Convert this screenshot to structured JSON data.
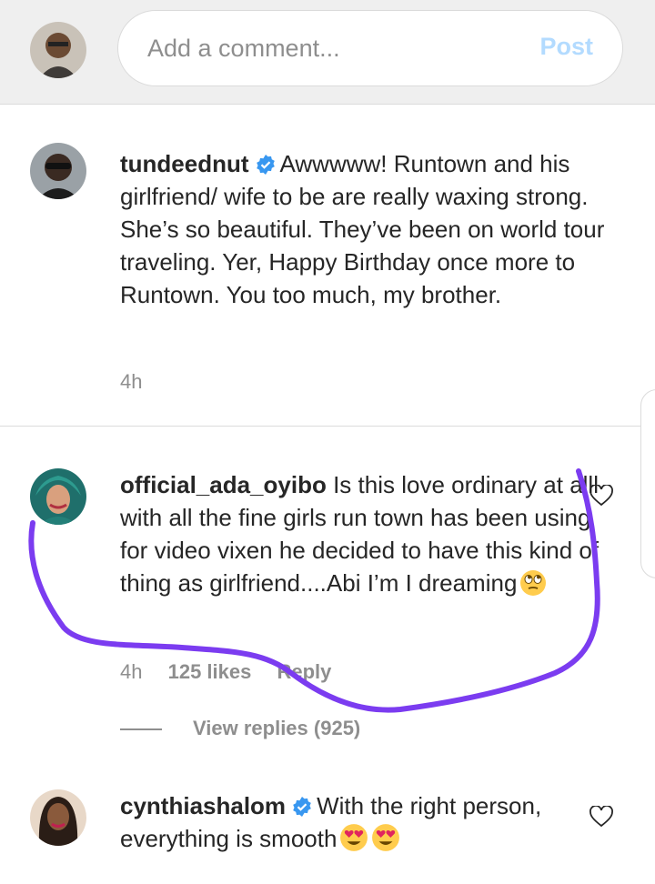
{
  "composer": {
    "placeholder": "Add a comment...",
    "post_label": "Post"
  },
  "comments": [
    {
      "username": "tundeednut",
      "verified": true,
      "text": "Awwwww! Runtown and his girlfriend/ wife to be are really waxing strong. She’s so beautiful. They’ve been on world tour traveling. Yer, Happy Birthday once more to Runtown. You too much, my brother.",
      "time": "4h"
    },
    {
      "username": "official_ada_oyibo",
      "verified": false,
      "text": "Is this love ordinary at alll with all the fine girls run town has been using for video vixen he decided to have this kind of thing as girlfriend....Abi I’m I dreaming",
      "emoji": "face-with-rolling-eyes",
      "time": "4h",
      "likes": "125 likes",
      "reply_label": "Reply",
      "view_replies": "View replies (925)"
    },
    {
      "username": "cynthiashalom",
      "verified": true,
      "text": "With the right person, everything is smooth",
      "emoji": "heart-eyes-face",
      "emoji_count": 2
    }
  ],
  "colors": {
    "annotation": "#7b3cf0",
    "verified": "#3897f0",
    "post_disabled": "#b3dbff"
  }
}
